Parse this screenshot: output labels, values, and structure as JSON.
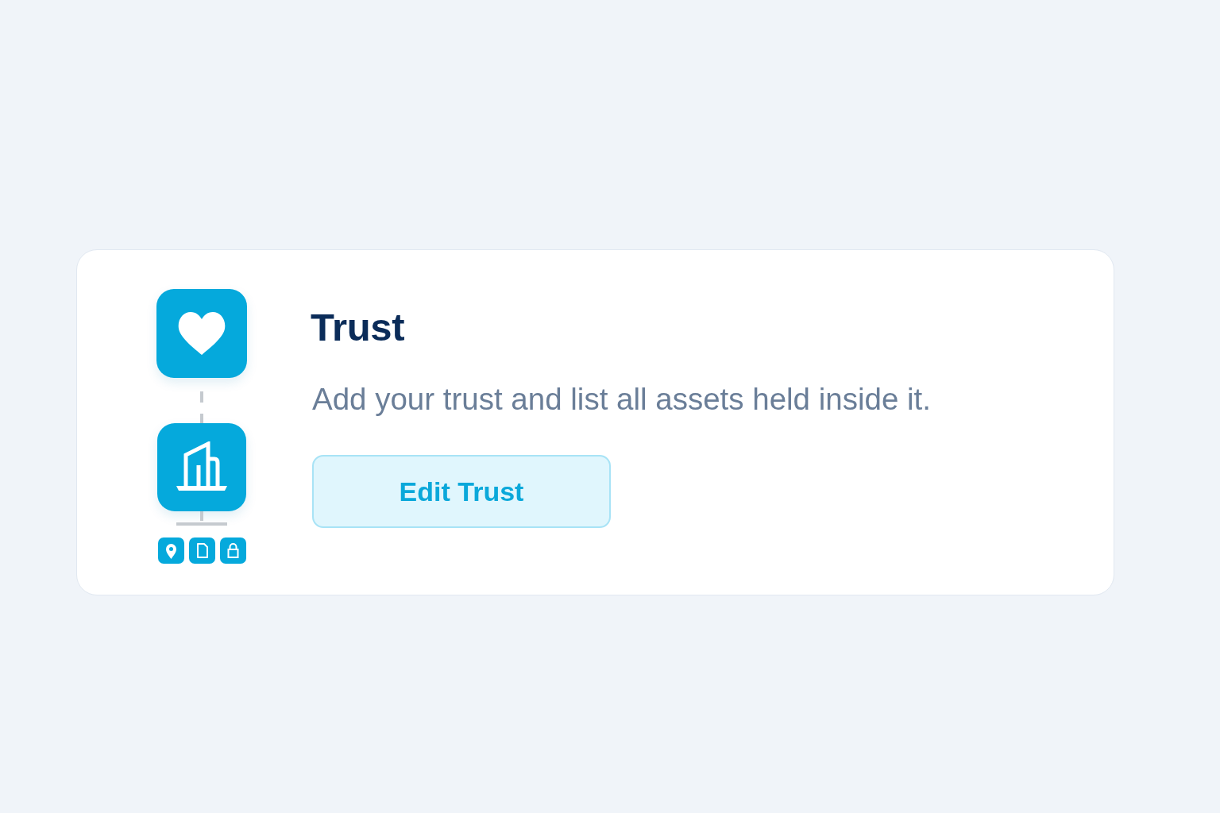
{
  "card": {
    "title": "Trust",
    "description": "Add your trust and list all assets held inside it.",
    "button": {
      "label": "Edit Trust"
    }
  }
}
